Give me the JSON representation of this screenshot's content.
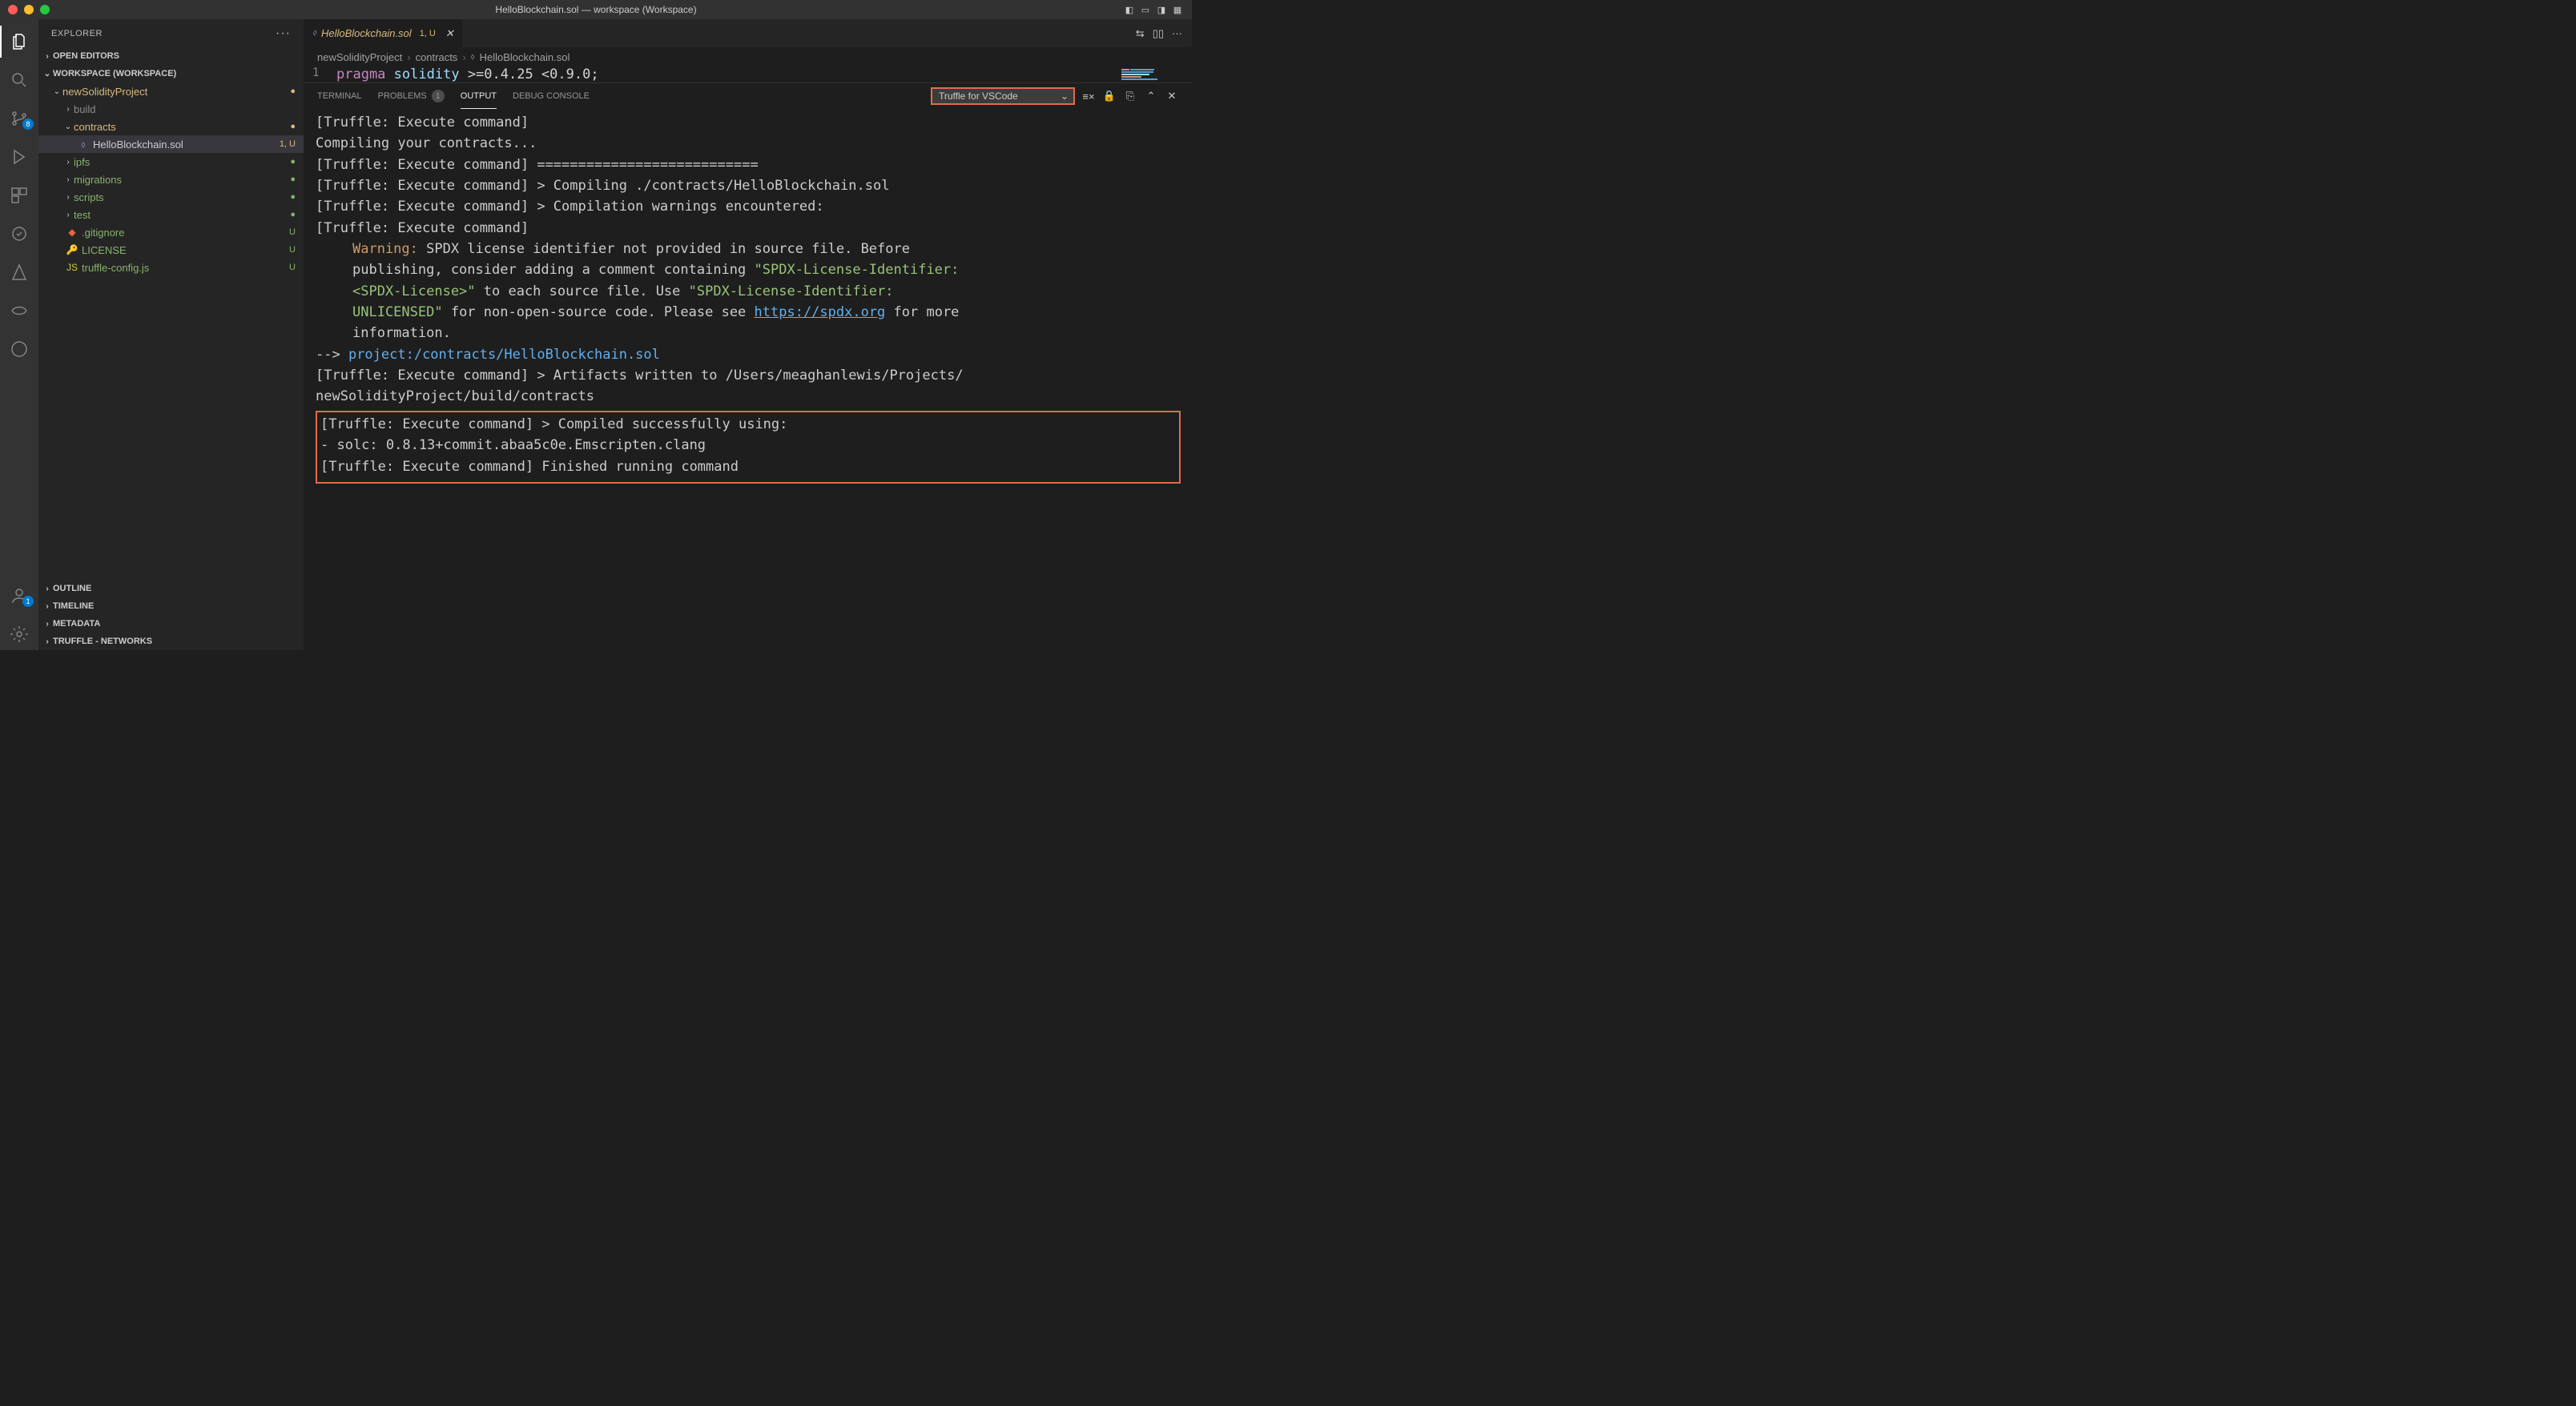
{
  "title": "HelloBlockchain.sol — workspace (Workspace)",
  "explorer": {
    "label": "EXPLORER",
    "open_editors": "OPEN EDITORS",
    "workspace": "WORKSPACE (WORKSPACE)",
    "outline": "OUTLINE",
    "timeline": "TIMELINE",
    "metadata": "METADATA",
    "truffle_networks": "TRUFFLE - NETWORKS"
  },
  "tree": {
    "project": "newSolidityProject",
    "build": "build",
    "contracts": "contracts",
    "hello": "HelloBlockchain.sol",
    "hello_status": "1, U",
    "ipfs": "ipfs",
    "migrations": "migrations",
    "scripts": "scripts",
    "test": "test",
    "gitignore": ".gitignore",
    "license": "LICENSE",
    "truffle_config": "truffle-config.js"
  },
  "git": {
    "u": "U",
    "dot": "●"
  },
  "tab": {
    "filename": "HelloBlockchain.sol",
    "status": "1, U"
  },
  "breadcrumb": {
    "p1": "newSolidityProject",
    "p2": "contracts",
    "p3": "HelloBlockchain.sol"
  },
  "code": {
    "lineno": "1",
    "kw": "pragma",
    "id": "solidity",
    "rest": ">=0.4.25 <0.9.0;"
  },
  "panel": {
    "terminal": "TERMINAL",
    "problems": "PROBLEMS",
    "problems_count": "1",
    "output": "OUTPUT",
    "debug": "DEBUG CONSOLE",
    "channel": "Truffle for VSCode"
  },
  "out": {
    "l1": "[Truffle: Execute command]",
    "l2": "Compiling your contracts...",
    "l3": "[Truffle: Execute command] ===========================",
    "l4": "[Truffle: Execute command] > Compiling ./contracts/HelloBlockchain.sol",
    "l5": "[Truffle: Execute command] > Compilation warnings encountered:",
    "l6": "[Truffle: Execute command]",
    "warn_label": "Warning:",
    "warn1": " SPDX license identifier not provided in source file. Before",
    "warn2a": "publishing, consider adding a comment containing ",
    "warn2b": "\"SPDX-License-Identifier:",
    "warn3a": "<SPDX-License>\"",
    "warn3b": " to each source file. Use ",
    "warn3c": "\"SPDX-License-Identifier:",
    "warn4a": "UNLICENSED\"",
    "warn4b": " for non-open-source code. Please see ",
    "warn_link": "https://spdx.org",
    "warn4c": " for more",
    "warn5": "information.",
    "arrow": "--> ",
    "proj_path": "project:/contracts/HelloBlockchain.sol",
    "blank": " ",
    "art1": "[Truffle: Execute command] > Artifacts written to /Users/meaghanlewis/Projects/",
    "art2": "newSolidityProject/build/contracts",
    "ok1": "[Truffle: Execute command] > Compiled successfully using:",
    "ok2": "   - solc: 0.8.13+commit.abaa5c0e.Emscripten.clang",
    "ok3": "[Truffle: Execute command] Finished running command"
  },
  "activity": {
    "scm_badge": "8",
    "account_badge": "1"
  }
}
